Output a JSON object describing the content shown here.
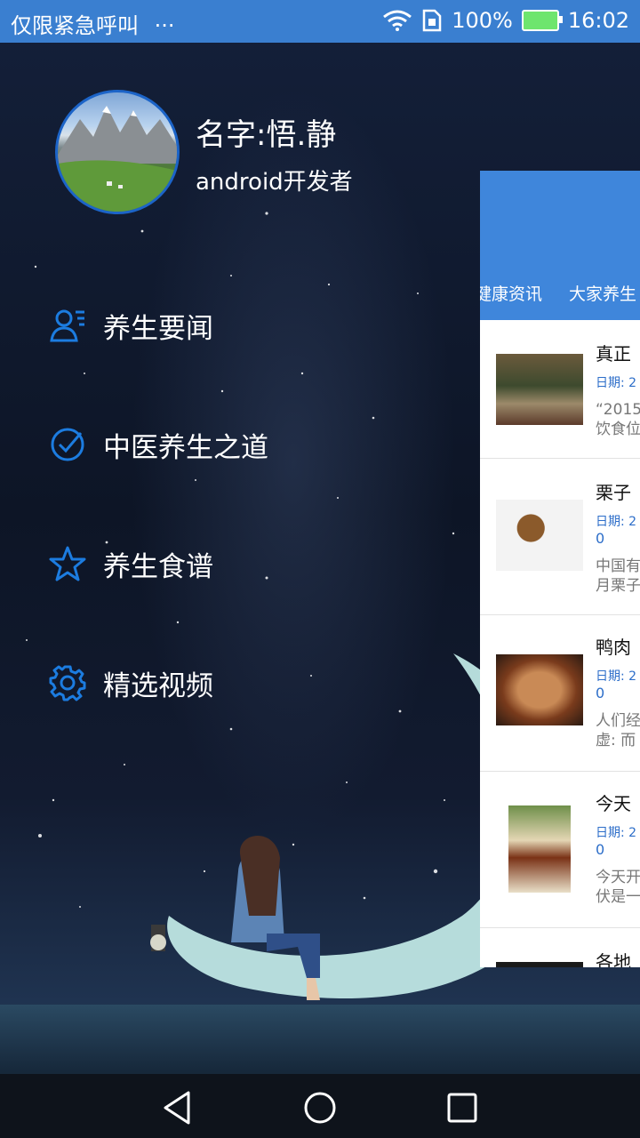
{
  "status_bar": {
    "carrier": "仅限紧急呼叫",
    "more": "···",
    "battery": "100%",
    "time": "16:02"
  },
  "drawer": {
    "name": "名字:悟.静",
    "role": "android开发者",
    "menu": [
      {
        "label": "养生要闻",
        "icon": "contacts-icon"
      },
      {
        "label": "中医养生之道",
        "icon": "check-circle-icon"
      },
      {
        "label": "养生食谱",
        "icon": "star-icon"
      },
      {
        "label": "精选视频",
        "icon": "gear-icon"
      }
    ]
  },
  "content": {
    "tabs": [
      "健康资讯",
      "大家养生"
    ],
    "news": [
      {
        "title": "真正",
        "date": "日期: 2",
        "zero": "",
        "desc1": "“2015",
        "desc2": "饮食位"
      },
      {
        "title": "栗子",
        "date": "日期: 2",
        "zero": "0",
        "desc1": "中国有",
        "desc2": "月栗子"
      },
      {
        "title": "鸭肉",
        "date": "日期: 2",
        "zero": "0",
        "desc1": "人们经",
        "desc2": "虚: 而"
      },
      {
        "title": "今天",
        "date": "日期: 2",
        "zero": "0",
        "desc1": "今天开",
        "desc2": "伏是一"
      },
      {
        "title": "各地",
        "date": "",
        "zero": "",
        "desc1": "",
        "desc2": ""
      }
    ]
  },
  "colors": {
    "status_bar": "#3a7fd0",
    "accent": "#1c7ce0",
    "app_bar": "#3f86db"
  }
}
